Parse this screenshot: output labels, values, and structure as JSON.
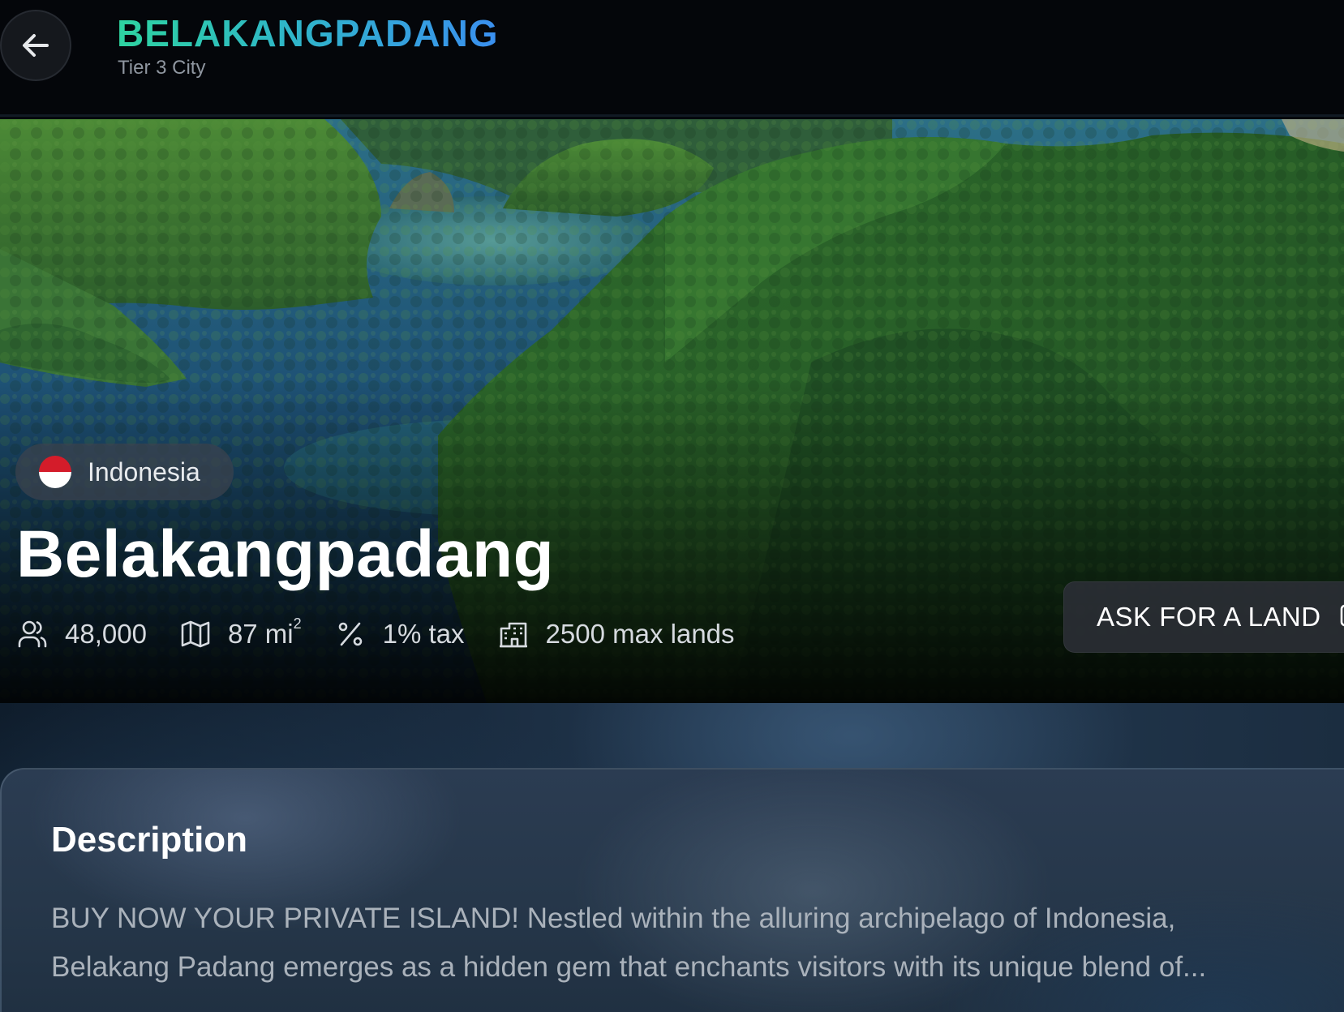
{
  "header": {
    "title": "BELAKANGPADANG",
    "subtitle": "Tier 3 City",
    "back_icon": "arrow-left-icon"
  },
  "hero": {
    "country": "Indonesia",
    "country_flag": {
      "top": "#d41c2a",
      "bottom": "#ffffff"
    },
    "city_name": "Belakangpadang",
    "stats": {
      "population": "48,000",
      "area_value": "87 mi",
      "area_unit_exp": "2",
      "tax": "1% tax",
      "max_lands": "2500 max lands"
    },
    "stat_icons": [
      "users-icon",
      "map-icon",
      "percent-icon",
      "building-icon"
    ],
    "ask_button": "ASK FOR A LAND"
  },
  "description": {
    "title": "Description",
    "line1": "BUY NOW YOUR PRIVATE ISLAND! Nestled within the alluring archipelago of Indonesia,",
    "line2": "Belakang Padang emerges as a hidden gem that enchants visitors with its unique blend of..."
  },
  "colors": {
    "title_gradient_start": "#2ed3a0",
    "title_gradient_end": "#3a8ff0",
    "background": "#05080d"
  }
}
